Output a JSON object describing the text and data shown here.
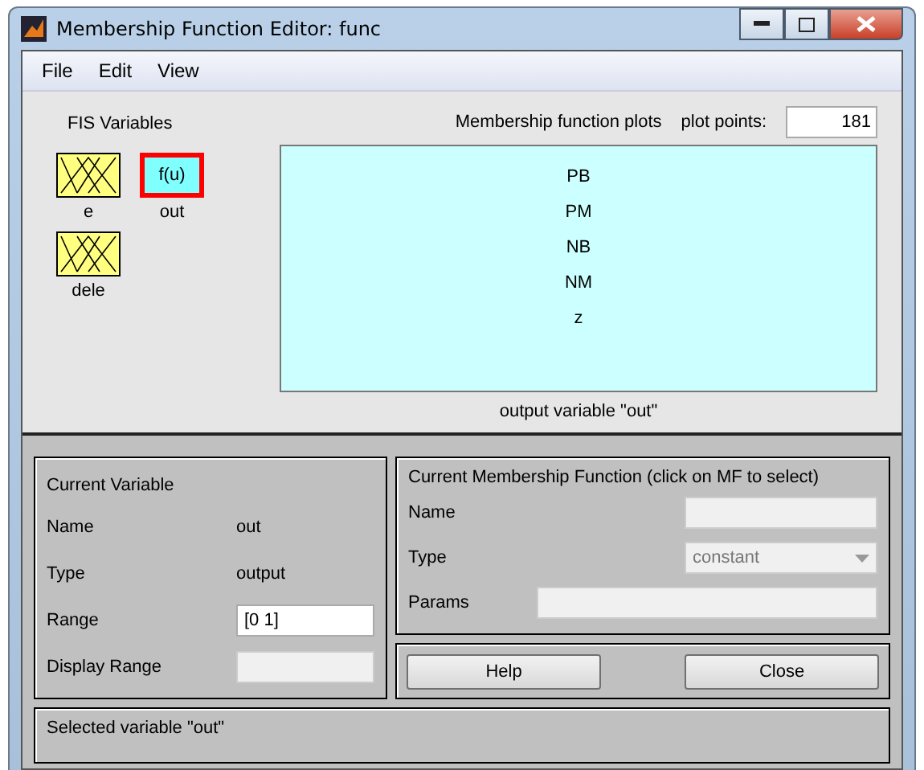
{
  "window": {
    "title": "Membership Function Editor: func"
  },
  "menu": [
    "File",
    "Edit",
    "View"
  ],
  "fis_variables": {
    "title": "FIS Variables",
    "items": [
      {
        "name": "e",
        "kind": "input",
        "selected": false
      },
      {
        "name": "out",
        "kind": "output",
        "label": "f(u)",
        "selected": true
      },
      {
        "name": "dele",
        "kind": "input",
        "selected": false
      }
    ]
  },
  "plot": {
    "title": "Membership function plots",
    "points_label": "plot points:",
    "points": "181",
    "mfs": [
      "PB",
      "PM",
      "NB",
      "NM",
      "z"
    ],
    "caption": "output variable \"out\""
  },
  "current_variable": {
    "title": "Current Variable",
    "name_label": "Name",
    "name": "out",
    "type_label": "Type",
    "type": "output",
    "range_label": "Range",
    "range": "[0 1]",
    "display_range_label": "Display Range"
  },
  "current_mf": {
    "title": "Current Membership Function (click on MF to select)",
    "name_label": "Name",
    "type_label": "Type",
    "type": "constant",
    "params_label": "Params"
  },
  "buttons": [
    "Help",
    "Close"
  ],
  "status": "Selected variable \"out\""
}
